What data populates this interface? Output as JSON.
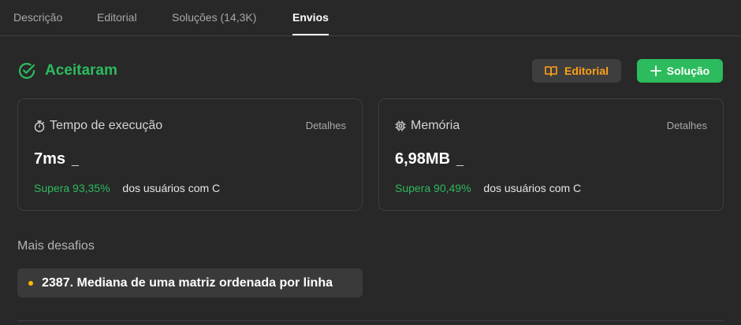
{
  "tabs": [
    {
      "label": "Descrição"
    },
    {
      "label": "Editorial"
    },
    {
      "label": "Soluções (14,3K)"
    },
    {
      "label": "Envios"
    }
  ],
  "status": {
    "text": "Aceitaram",
    "color": "#2cbb5d"
  },
  "buttons": {
    "editorial": "Editorial",
    "solution": "Solução"
  },
  "runtime": {
    "title": "Tempo de execução",
    "details": "Detalhes",
    "value": "7ms",
    "suffix": "_",
    "beats": "Supera 93,35%",
    "users": "dos usuários com C"
  },
  "memory": {
    "title": "Memória",
    "details": "Detalhes",
    "value": "6,98MB",
    "suffix": "_",
    "beats": "Supera 90,49%",
    "users": "dos usuários com C"
  },
  "more_challenges": {
    "title": "Mais desafios",
    "items": [
      {
        "label": "2387. Mediana de uma matriz ordenada por linha"
      }
    ]
  },
  "icons": {
    "status": "check-circle-icon",
    "editorial": "book-icon",
    "solution": "plus-icon",
    "runtime": "stopwatch-icon",
    "memory": "chip-icon",
    "challenge": "dot-icon"
  }
}
